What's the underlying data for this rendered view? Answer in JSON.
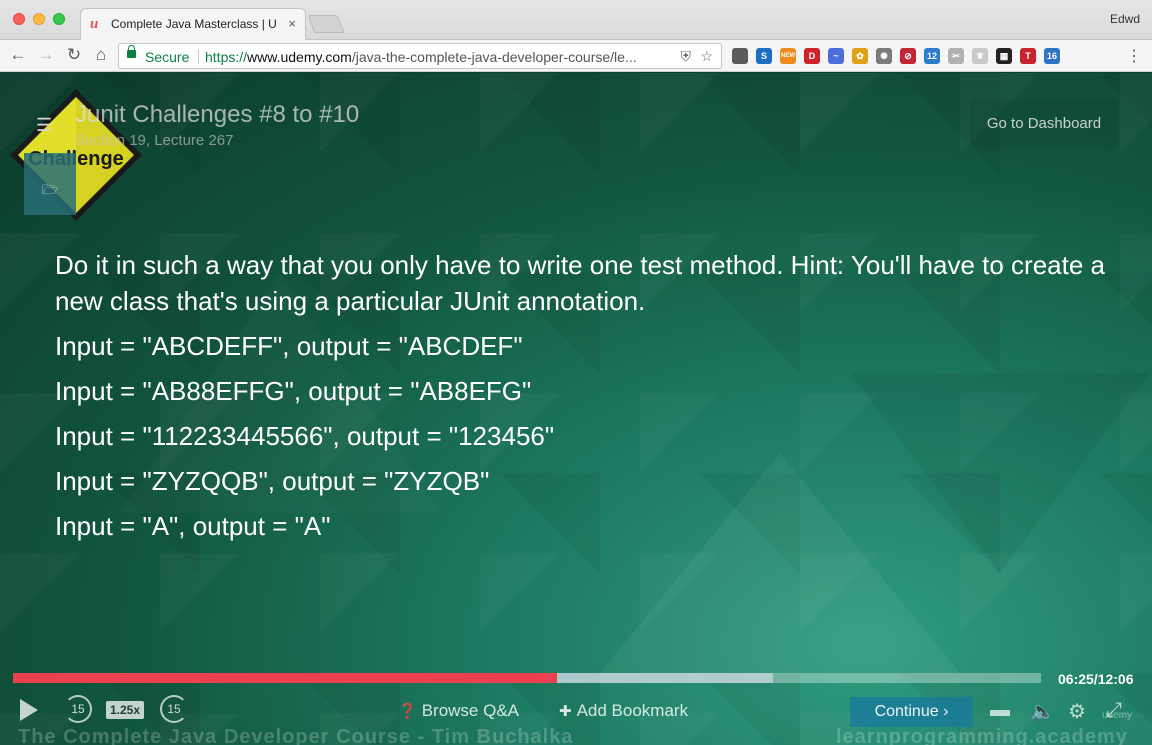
{
  "browser": {
    "tab_title": "Complete Java Masterclass | U",
    "tab_favicon": "u",
    "tab_close": "×",
    "profile_name": "Edwd",
    "secure_label": "Secure",
    "url_proto": "https://",
    "url_host": "www.udemy.com",
    "url_path": "/java-the-complete-java-developer-course/le...",
    "extensions": [
      {
        "name": "evernote-icon",
        "color": "#5a5a5a",
        "label": ""
      },
      {
        "name": "s-icon",
        "color": "#1e6fc3",
        "label": "S"
      },
      {
        "name": "new-badge-icon",
        "color": "#f08a1c",
        "label": "NEW"
      },
      {
        "name": "red-d-icon",
        "color": "#d0222c",
        "label": "D"
      },
      {
        "name": "swirl-icon",
        "color": "#4c6edb",
        "label": "~"
      },
      {
        "name": "multicolor-icon",
        "color": "#e2a11a",
        "label": "✿"
      },
      {
        "name": "gear-ext-icon",
        "color": "#7b7b7b",
        "label": "✺"
      },
      {
        "name": "block-icon",
        "color": "#c2243a",
        "label": "⊘"
      },
      {
        "name": "s12-icon",
        "color": "#2d7cc9",
        "label": "12"
      },
      {
        "name": "scissors-icon",
        "color": "#b0b0b0",
        "label": "✂"
      },
      {
        "name": "leaf-icon",
        "color": "#c8c8c8",
        "label": "❦"
      },
      {
        "name": "grid-icon",
        "color": "#222222",
        "label": "▦"
      },
      {
        "name": "t-icon",
        "color": "#c8232f",
        "label": "T"
      },
      {
        "name": "calendar16-icon",
        "color": "#2f74c4",
        "label": "16"
      }
    ]
  },
  "lecture": {
    "title": "Junit Challenges #8 to #10",
    "subtitle": "Section 19, Lecture 267",
    "dashboard_label": "Go to Dashboard",
    "challenge_sign_text": "Challenge"
  },
  "slide": {
    "hint": "Do it in such a way that you only have to write one test method. Hint: You'll have to create a new class that's using a particular JUnit annotation.",
    "lines": [
      "Input = \"ABCDEFF\", output = \"ABCDEF\"",
      "Input = \"AB88EFFG\", output = \"AB8EFG\"",
      "Input = \"112233445566\", output = \"123456\"",
      "Input = \"ZYZQQB\", output = \"ZYZQB\"",
      "Input = \"A\", output = \"A\""
    ]
  },
  "player": {
    "time_display": "06:25/12:06",
    "played_fraction": 0.529,
    "buffered_fraction": 0.739,
    "skip_back_label": "15",
    "skip_forward_label": "15",
    "playback_rate": "1.25x",
    "browse_qa_label": "Browse Q&A",
    "add_bookmark_label": "Add Bookmark",
    "continue_label": "Continue ›",
    "watermark_left": "The Complete Java Developer Course - Tim Buchalka",
    "watermark_right": "learnprogramming.academy",
    "brand_label": "udemy"
  },
  "colors": {
    "progress_played": "#ec3f50",
    "accent_green_secure": "#0b8043"
  }
}
